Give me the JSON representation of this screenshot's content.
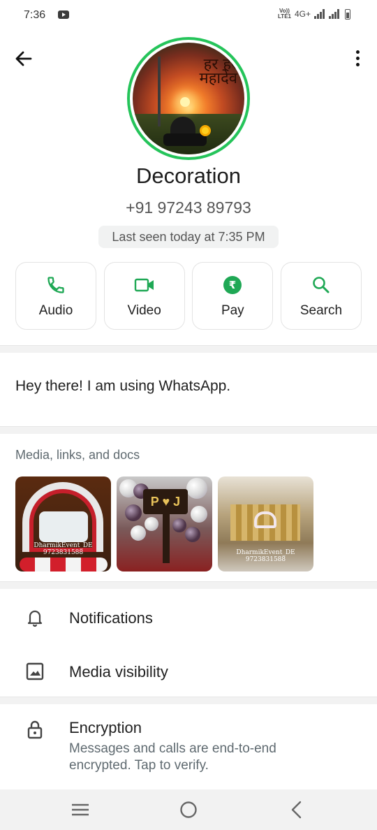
{
  "status_bar": {
    "time": "7:36",
    "volte": "Vo))\nLTE1",
    "network": "4G+",
    "icons": [
      "youtube-icon",
      "signal-icon",
      "signal-icon",
      "battery-icon"
    ]
  },
  "header": {
    "avatar_text": "हर हर महादेव",
    "name": "Decoration",
    "phone": "+91 97243 89793",
    "last_seen": "Last seen today at 7:35 PM"
  },
  "actions": [
    {
      "label": "Audio",
      "icon": "phone-icon"
    },
    {
      "label": "Video",
      "icon": "video-icon"
    },
    {
      "label": "Pay",
      "icon": "rupee-icon"
    },
    {
      "label": "Search",
      "icon": "search-icon"
    }
  ],
  "about": "Hey there! I am using WhatsApp.",
  "media": {
    "title": "Media, links, and docs",
    "items": [
      {
        "watermark": "DharmikEvent_DE\n9723831588"
      },
      {
        "board_text": "P ♥ J"
      },
      {
        "watermark": "DharmikEvent_DE\n9723831588"
      }
    ]
  },
  "settings": {
    "notifications": "Notifications",
    "media_visibility": "Media visibility"
  },
  "encryption": {
    "title": "Encryption",
    "subtitle": "Messages and calls are end-to-end encrypted. Tap to verify."
  },
  "colors": {
    "accent_green": "#1fa855",
    "ring_green": "#25c45a"
  }
}
